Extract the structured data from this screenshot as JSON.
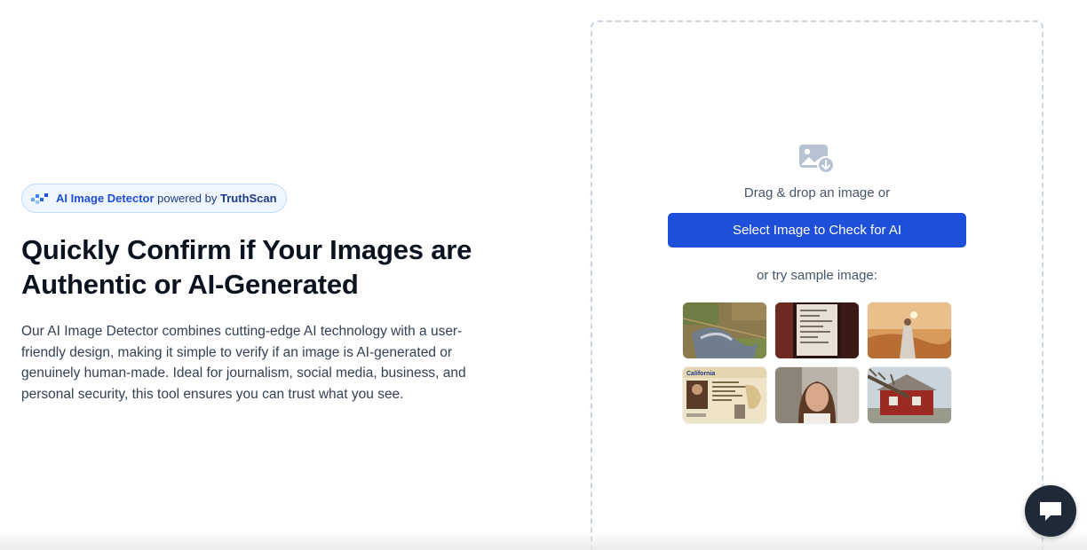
{
  "badge": {
    "product": "AI Image Detector",
    "powered_by": "powered by",
    "brand": "TruthScan"
  },
  "hero": {
    "title": "Quickly Confirm if Your Images are Authentic or AI-Generated",
    "description": "Our AI Image Detector combines cutting-edge AI technology with a user-friendly design, making it simple to verify if an image is AI-generated or genuinely human-made. Ideal for journalism, social media, business, and personal security, this tool ensures you can trust what you see."
  },
  "upload": {
    "icon": "image-upload-icon",
    "drag_text": "Drag & drop an image or",
    "button_label": "Select Image to Check for AI",
    "sample_text": "or try sample image:"
  },
  "samples": [
    {
      "icon": "aerial-town-thumbnail"
    },
    {
      "icon": "receipt-thumbnail"
    },
    {
      "icon": "desert-figure-thumbnail"
    },
    {
      "icon": "drivers-license-thumbnail"
    },
    {
      "icon": "selfie-thumbnail"
    },
    {
      "icon": "fallen-tree-house-thumbnail"
    }
  ],
  "license_text": "California",
  "chat": {
    "icon": "chat-icon"
  },
  "colors": {
    "accent": "#1d4fd8",
    "badge_bg": "#eff6ff",
    "text_dark": "#0b1220",
    "text_muted": "#475569"
  }
}
